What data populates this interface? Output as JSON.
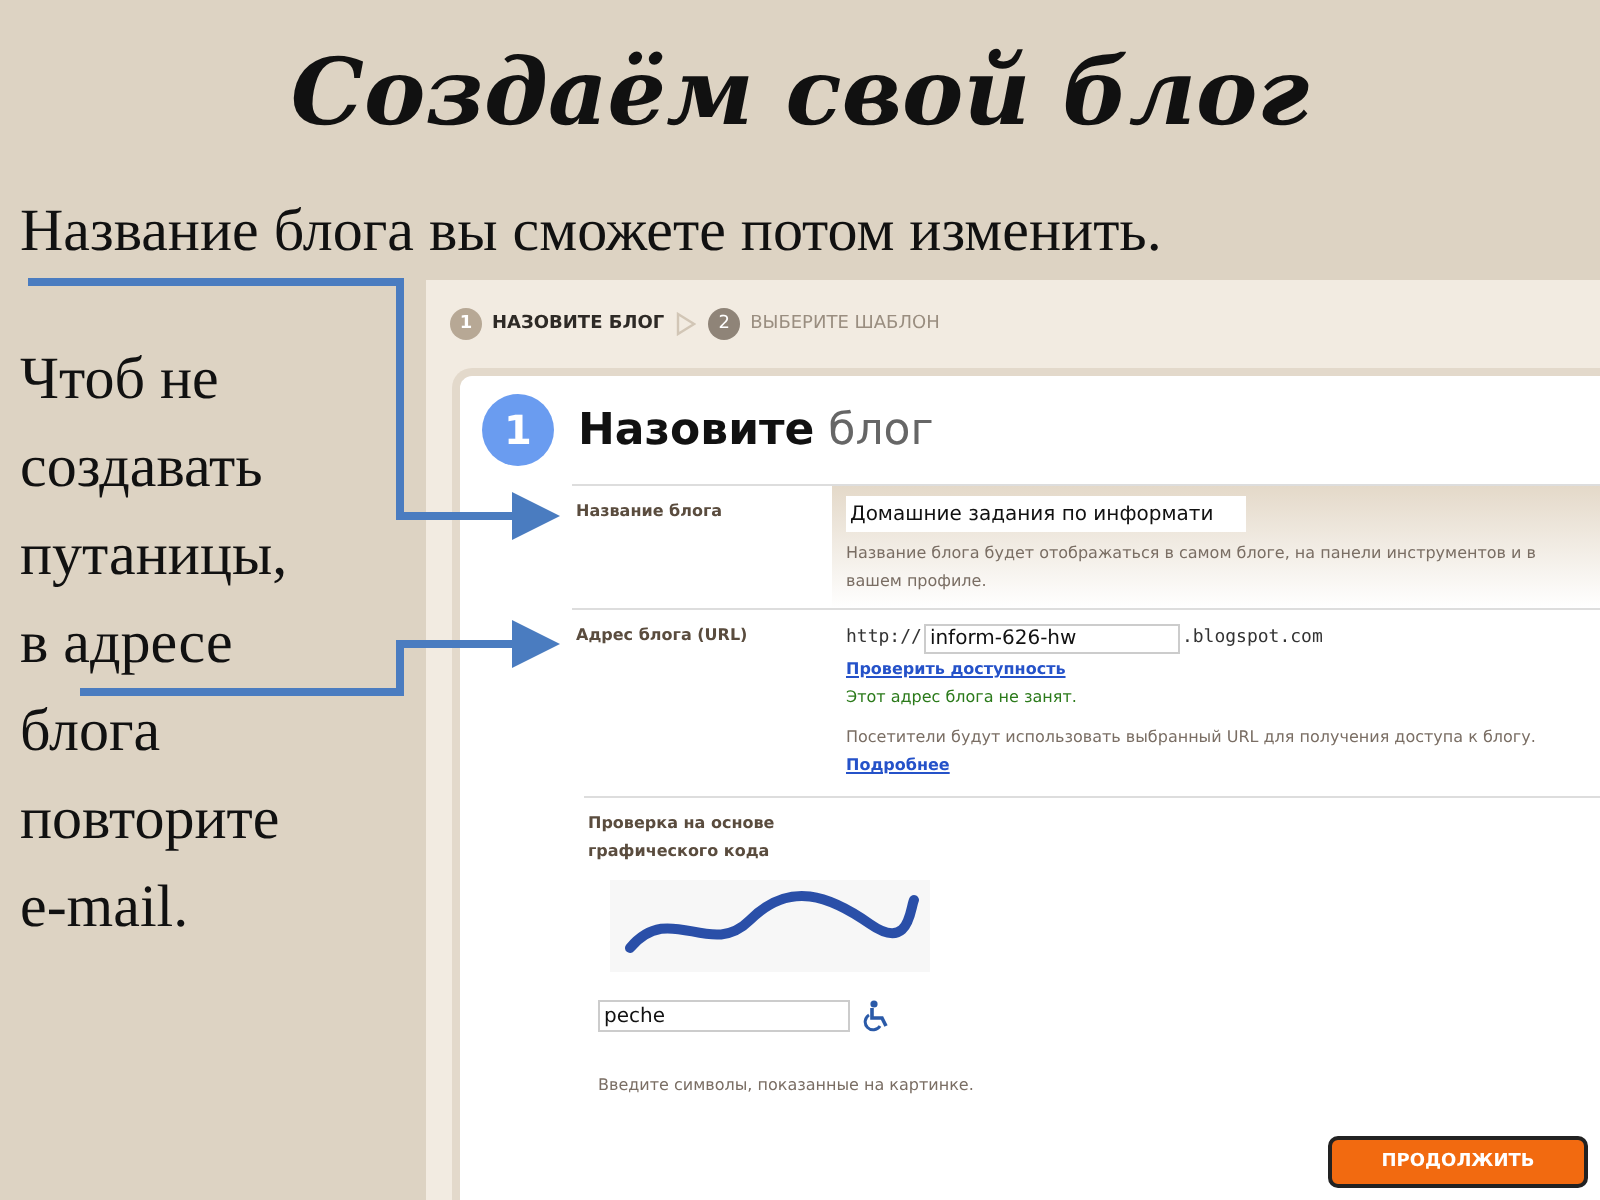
{
  "title": "Создаём свой блог",
  "subtitle": "Название блога вы сможете потом изменить.",
  "side_text": "Чтоб не создавать путаницы, в адресе блога повторите e-mail.",
  "screenshot": {
    "steps": [
      {
        "number": "1",
        "label": "НАЗОВИТЕ БЛОГ",
        "selected": true
      },
      {
        "number": "2",
        "label": "ВЫБЕРИТЕ ШАБЛОН",
        "selected": false
      }
    ],
    "heading": {
      "number": "1",
      "text": "**Назовите** блог"
    },
    "rows": [
      {
        "kind": "name",
        "label": "Название блога",
        "value": "Домашние задания по информати",
        "hint": "Название блога будет отображаться в самом блоге, на панели инструментов и в вашем профиле."
      },
      {
        "kind": "url",
        "label": "Адрес блога (URL)",
        "prefix": "http://",
        "value": "inform-626-hw",
        "suffix": ".blogspot.com",
        "check_link": "Проверить доступность",
        "status": "Этот адрес блога не занят.",
        "hint": "Посетители будут использовать выбранный URL для получения доступа к блогу.",
        "more_link": "Подробнее"
      },
      {
        "kind": "captcha",
        "label": "Проверка на основе графического кода",
        "value": "peche",
        "hint": "Введите символы, показанные на картинке."
      }
    ],
    "continue_button": "ПРОДОЛЖИТЬ"
  }
}
